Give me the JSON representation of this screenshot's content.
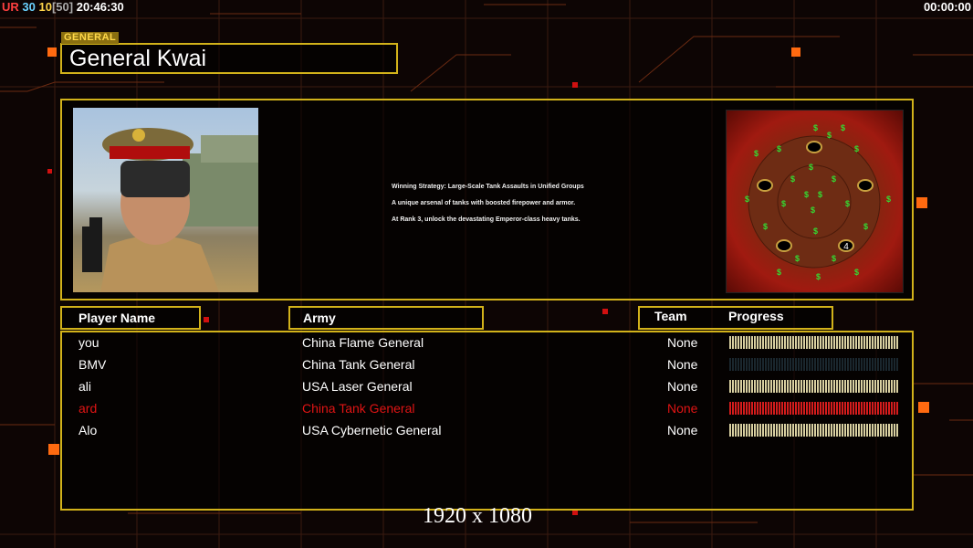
{
  "hud": {
    "ur": "UR",
    "v1": "30",
    "v2": "10",
    "v3": "[50]",
    "clock": "20:46:30",
    "timer": "00:00:00"
  },
  "general": {
    "tag": "GENERAL",
    "name": "General Kwai",
    "strategy": [
      "Winning Strategy: Large-Scale Tank Assaults in Unified Groups",
      "A unique arsenal of tanks with boosted firepower and armor.",
      "At Rank 3, unlock the devastating Emperor-class heavy tanks."
    ],
    "map_player_marker": "4"
  },
  "headers": {
    "player_name": "Player Name",
    "army": "Army",
    "team": "Team",
    "progress": "Progress"
  },
  "players": [
    {
      "name": "you",
      "army": "China Flame General",
      "team": "None",
      "progress": 1.0,
      "color": "#ffffff",
      "bar_color": "#d8cfa0"
    },
    {
      "name": "BMV",
      "army": "China Tank General",
      "team": "None",
      "progress": 0.0,
      "color": "#ffffff",
      "bar_color": "#2a3b44"
    },
    {
      "name": "ali",
      "army": "USA Laser General",
      "team": "None",
      "progress": 1.0,
      "color": "#ffffff",
      "bar_color": "#d8cfa0"
    },
    {
      "name": "ard",
      "army": "China Tank General",
      "team": "None",
      "progress": 1.0,
      "color": "#e01414",
      "bar_color": "#d41c1c"
    },
    {
      "name": "Alo",
      "army": "USA Cybernetic General",
      "team": "None",
      "progress": 1.0,
      "color": "#ffffff",
      "bar_color": "#d8cfa0"
    }
  ],
  "resolution_label": "1920 x 1080",
  "colors": {
    "frame": "#d2b21a",
    "accent_orange": "#ff6a10",
    "background": "#0d0504"
  }
}
